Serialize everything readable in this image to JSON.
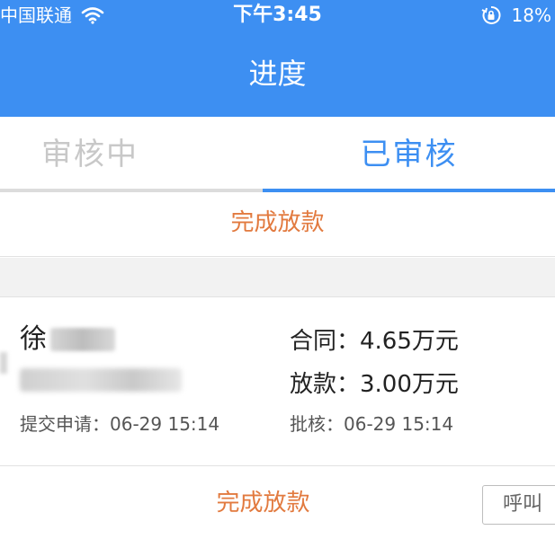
{
  "status_bar": {
    "carrier": "中国联通",
    "time": "下午3:45",
    "battery": "18%"
  },
  "nav": {
    "title": "进度"
  },
  "tabs": [
    {
      "label": "审核中",
      "active": false
    },
    {
      "label": "已审核",
      "active": true
    }
  ],
  "summary": {
    "status": "完成放款"
  },
  "record": {
    "name_visible": "徐",
    "submit_time": "提交申请：06-29 15:14",
    "contract": "合同：4.65万元",
    "loan": "放款：3.00万元",
    "approve_time": "批核：06-29 15:14",
    "status": "完成放款",
    "call_label": "呼叫"
  },
  "colors": {
    "primary": "#3d8ff2",
    "status": "#e27a3f"
  },
  "icons": [
    "wifi-icon",
    "lock-rotation-icon"
  ]
}
